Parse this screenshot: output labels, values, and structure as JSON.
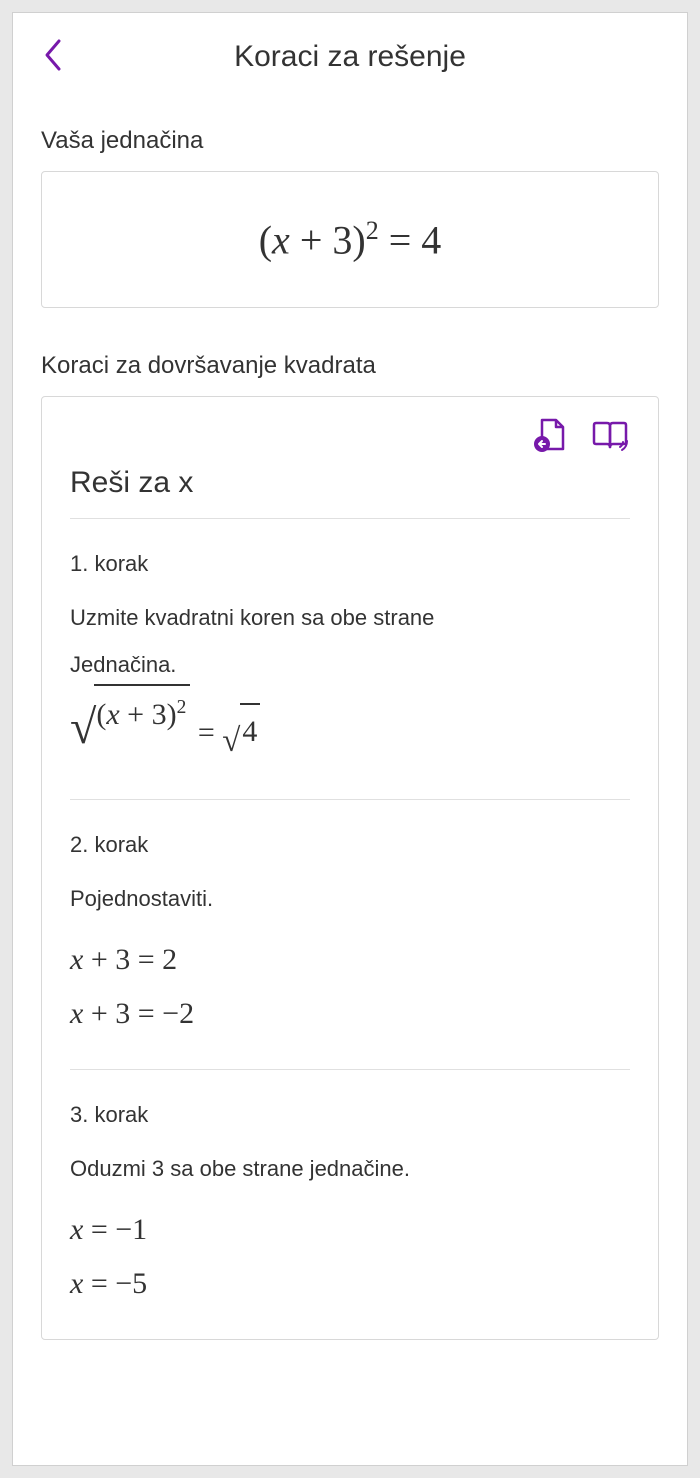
{
  "colors": {
    "accent": "#7719aa"
  },
  "header": {
    "title": "Koraci za rešenje"
  },
  "your_equation": {
    "label": "Vaša jednačina",
    "equation_display": "(x + 3)² = 4"
  },
  "steps_section": {
    "label": "Koraci za dovršavanje kvadrata",
    "solve_title": "Reši za x",
    "icons": {
      "copy_step": "page-insert-icon",
      "read_aloud": "read-aloud-icon"
    },
    "steps": [
      {
        "num": "1. korak",
        "desc": "Uzmite kvadratni koren sa obe strane",
        "sublabel": "Jednačina.",
        "math_display": "√((x + 3)²) = √4"
      },
      {
        "num": "2. korak",
        "desc": "Pojednostaviti.",
        "math_lines": [
          "x + 3 = 2",
          "x + 3 = −2"
        ]
      },
      {
        "num": "3. korak",
        "desc": "Oduzmi 3 sa obe strane jednačine.",
        "math_lines": [
          "x = −1",
          "x = −5"
        ]
      }
    ]
  }
}
